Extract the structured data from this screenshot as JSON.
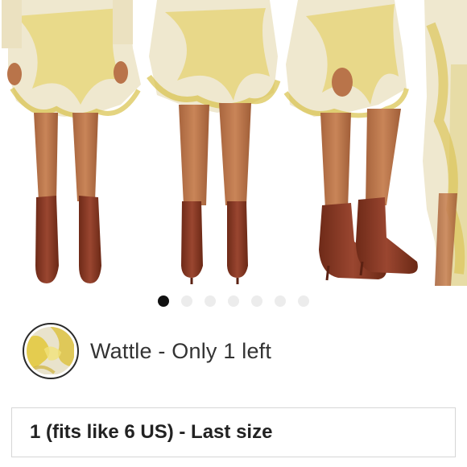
{
  "carousel": {
    "total_images": 7,
    "active_index": 0
  },
  "color": {
    "swatch_icon": "yellow-floral-swatch",
    "label": "Wattle - Only 1 left"
  },
  "size": {
    "label": "1 (fits like 6 US) - Last size"
  },
  "colors": {
    "dot_active": "#111111",
    "dot_inactive": "#ececec",
    "swatch_border": "#2a2a2a",
    "boot_brown": "#8a3b26",
    "fabric_yellow": "#e6cf45"
  }
}
